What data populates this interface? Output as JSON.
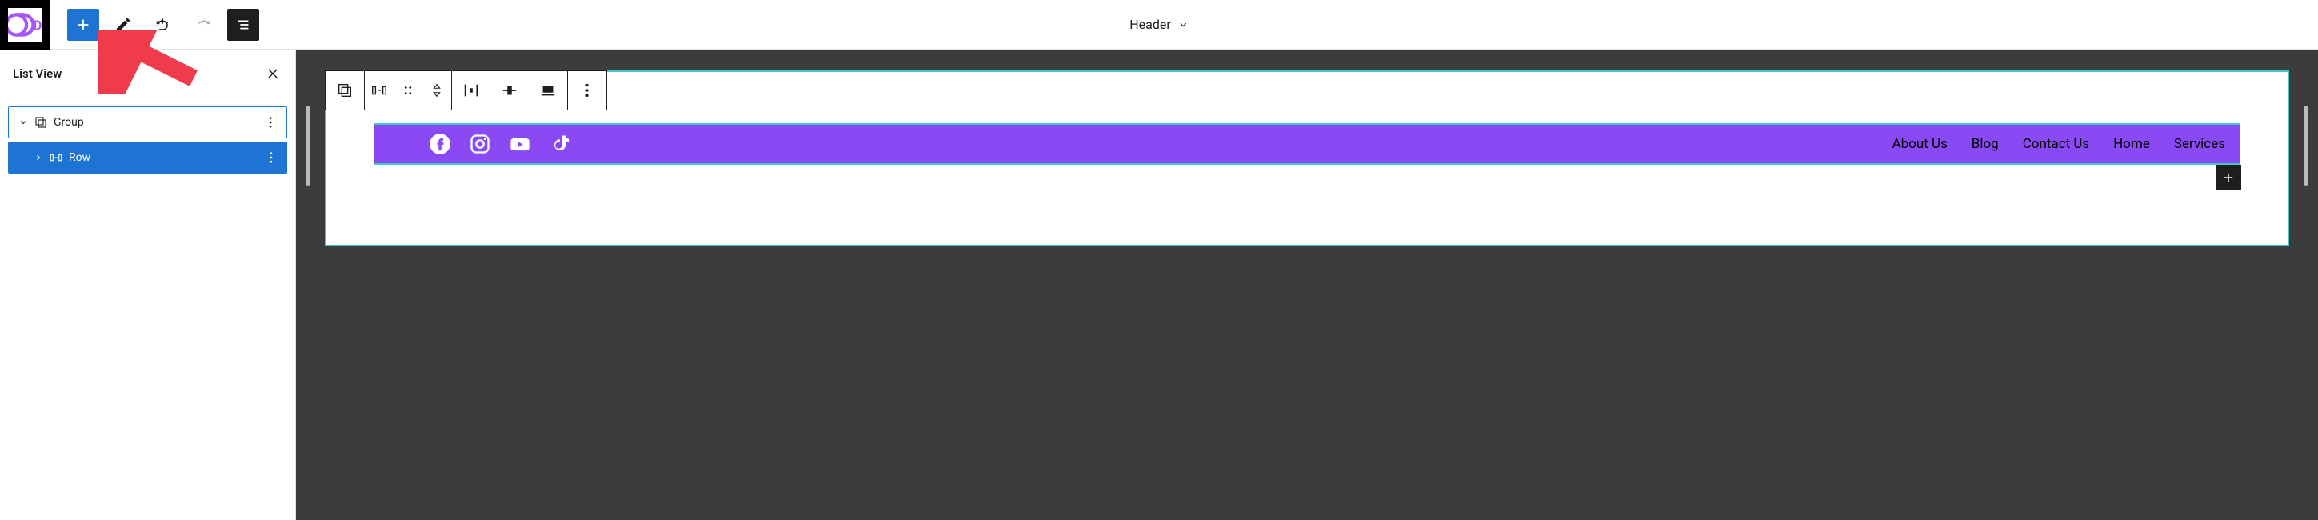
{
  "toolbar": {
    "add_label": "Add block",
    "edit_label": "Edit",
    "undo_label": "Undo",
    "redo_label": "Redo",
    "listview_label": "List View"
  },
  "document": {
    "title": "Header"
  },
  "sidebar": {
    "title": "List View",
    "close_label": "Close",
    "items": [
      {
        "label": "Group",
        "depth": 0,
        "expanded": true,
        "selected": false
      },
      {
        "label": "Row",
        "depth": 1,
        "expanded": false,
        "selected": true
      }
    ]
  },
  "block_toolbar": {
    "parent_label": "Select parent",
    "transform_label": "Change block type",
    "drag_label": "Drag",
    "move_label": "Move up/down",
    "justify_label": "Justify",
    "align_label": "Align",
    "wide_label": "Full width",
    "options_label": "Options"
  },
  "header_row": {
    "bg": "#8a4af3",
    "socials": [
      {
        "name": "facebook-icon"
      },
      {
        "name": "instagram-icon"
      },
      {
        "name": "youtube-icon"
      },
      {
        "name": "tiktok-icon"
      }
    ],
    "nav": [
      "About Us",
      "Blog",
      "Contact Us",
      "Home",
      "Services"
    ],
    "appender_label": "Add block"
  }
}
